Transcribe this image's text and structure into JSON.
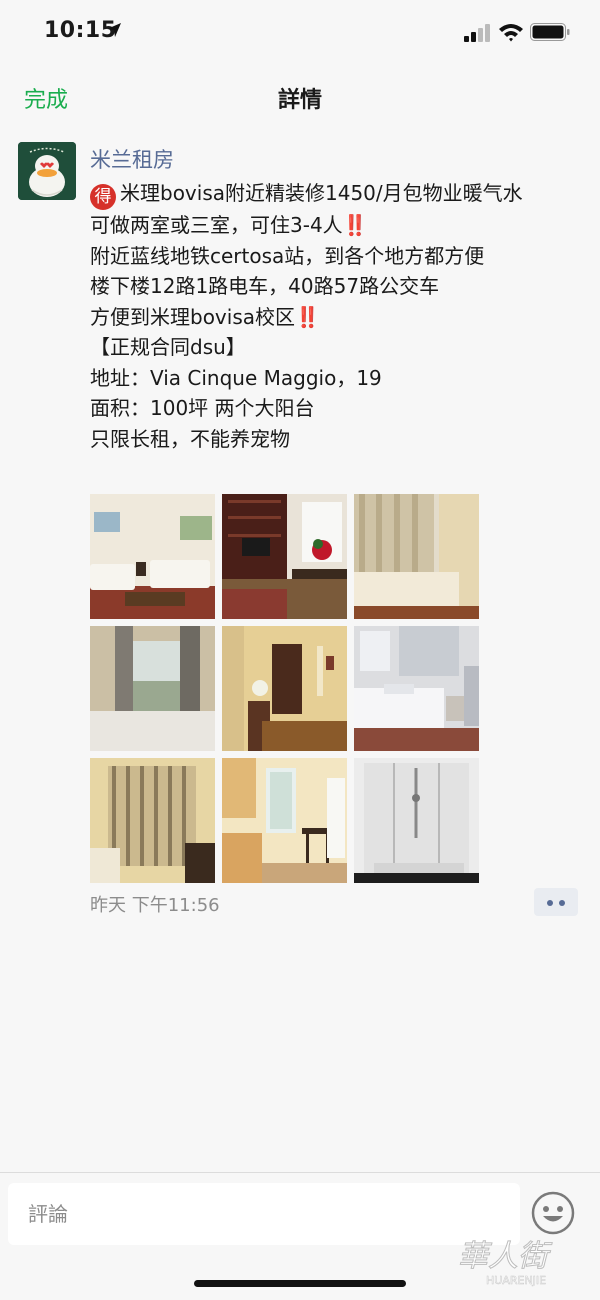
{
  "status_bar": {
    "time": "10:15"
  },
  "nav": {
    "done_label": "完成",
    "title": "詳情"
  },
  "post": {
    "author": "米兰租房",
    "badge_char": "得",
    "lines": [
      "米理bovisa附近精装修1450/月包物业暖气水",
      "可做两室或三室，可住3-4人",
      "附近蓝线地铁certosa站，到各个地方都方便",
      "楼下楼12路1路电车，40路57路公交车",
      "方便到米理bovisa校区",
      "【正规合同dsu】",
      "地址：Via Cinque Maggio，19",
      "面积：100坪  两个大阳台",
      "只限长租，不能养宠物"
    ],
    "emphasis": "‼️",
    "photos": [
      "living-room",
      "dining-room",
      "bedroom",
      "bedroom-window",
      "hallway",
      "bathroom",
      "bedroom-curtains",
      "kitchen",
      "shower"
    ],
    "timestamp": "昨天 下午11:56"
  },
  "comment": {
    "placeholder": "評論"
  },
  "watermark": {
    "text": "HUARENJIE"
  }
}
